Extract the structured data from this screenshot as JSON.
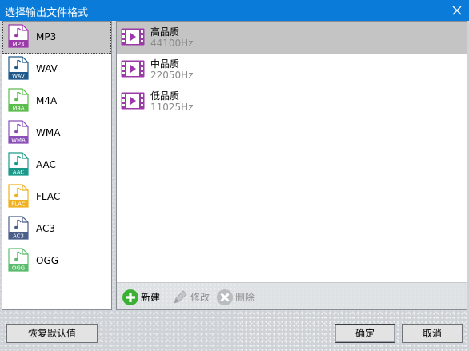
{
  "window": {
    "title": "选择输出文件格式"
  },
  "formats": [
    {
      "name": "MP3",
      "tag": "MP3",
      "color": "#9b3aa8",
      "selected": true
    },
    {
      "name": "WAV",
      "tag": "WAV",
      "color": "#1f5a8a",
      "selected": false
    },
    {
      "name": "M4A",
      "tag": "M4A",
      "color": "#5cbc4d",
      "selected": false
    },
    {
      "name": "WMA",
      "tag": "WMA",
      "color": "#8a4fb8",
      "selected": false
    },
    {
      "name": "AAC",
      "tag": "AAC",
      "color": "#1a9a8a",
      "selected": false
    },
    {
      "name": "FLAC",
      "tag": "FLAC",
      "color": "#f0b020",
      "selected": false
    },
    {
      "name": "AC3",
      "tag": "AC3",
      "color": "#4a5f8a",
      "selected": false
    },
    {
      "name": "OGG",
      "tag": "OGG",
      "color": "#5cbc6d",
      "selected": false
    }
  ],
  "qualities": [
    {
      "name": "高品质",
      "rate": "44100Hz",
      "selected": true
    },
    {
      "name": "中品质",
      "rate": "22050Hz",
      "selected": false
    },
    {
      "name": "低品质",
      "rate": "11025Hz",
      "selected": false
    }
  ],
  "toolbar": {
    "new_label": "新建",
    "edit_label": "修改",
    "delete_label": "删除"
  },
  "buttons": {
    "restore_default": "恢复默认值",
    "ok": "确定",
    "cancel": "取消"
  },
  "colors": {
    "titlebar": "#0a7bd8",
    "video_icon": "#9b3aa8",
    "add_icon": "#3cb034"
  }
}
